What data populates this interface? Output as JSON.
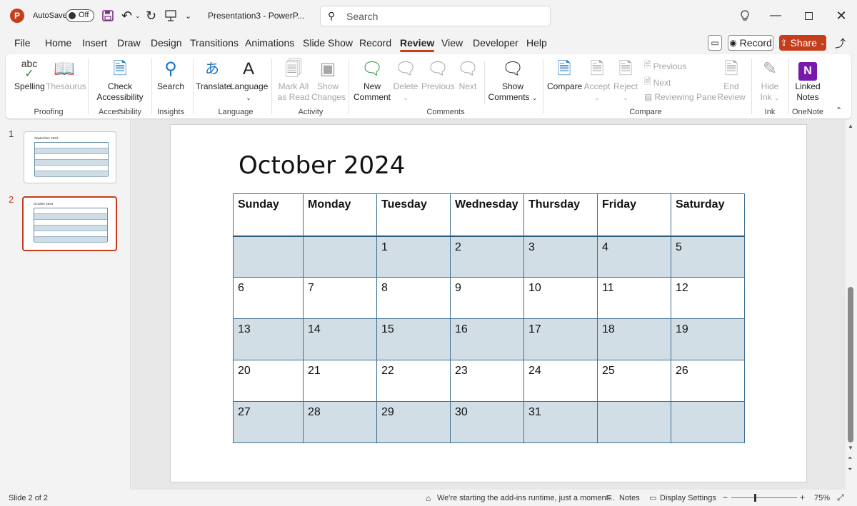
{
  "app": {
    "logo_letter": "P",
    "autosave_label": "AutoSave",
    "autosave_state": "Off",
    "document_title": "Presentation3  -  PowerP...",
    "search_placeholder": "Search",
    "brand_color": "#c43e1c"
  },
  "tabs": [
    "File",
    "Home",
    "Insert",
    "Draw",
    "Design",
    "Transitions",
    "Animations",
    "Slide Show",
    "Record",
    "Review",
    "View",
    "Developer",
    "Help"
  ],
  "active_tab": "Review",
  "tab_right": {
    "record_label": "Record",
    "share_label": "Share"
  },
  "ribbon": {
    "proofing": {
      "group": "Proofing",
      "spelling": "Spelling",
      "thesaurus": "Thesaurus",
      "spelling_icon_text": "abc"
    },
    "accessibility": {
      "group": "Accessibility",
      "check_line1": "Check",
      "check_line2": "Accessibility"
    },
    "insights": {
      "group": "Insights",
      "search": "Search"
    },
    "language": {
      "group": "Language",
      "translate": "Translate",
      "language": "Language"
    },
    "activity": {
      "group": "Activity",
      "mark_all_1": "Mark All",
      "mark_all_2": "as Read",
      "show_changes_1": "Show",
      "show_changes_2": "Changes"
    },
    "comments": {
      "group": "Comments",
      "new_1": "New",
      "new_2": "Comment",
      "delete": "Delete",
      "previous": "Previous",
      "next": "Next",
      "show_1": "Show",
      "show_2": "Comments"
    },
    "compare": {
      "group": "Compare",
      "compare": "Compare",
      "accept": "Accept",
      "reject": "Reject",
      "previous": "Previous",
      "next": "Next",
      "reviewing_pane": "Reviewing Pane",
      "end_1": "End",
      "end_2": "Review"
    },
    "ink": {
      "group": "Ink",
      "hide_1": "Hide",
      "hide_2": "Ink"
    },
    "onenote": {
      "group": "OneNote",
      "linked_1": "Linked",
      "linked_2": "Notes"
    }
  },
  "slides_pane": [
    {
      "number": "1",
      "title": "September 2024"
    },
    {
      "number": "2",
      "title": "October 2024"
    }
  ],
  "slide": {
    "title": "October 2024",
    "headers": [
      "Sunday",
      "Monday",
      "Tuesday",
      "Wednesday",
      "Thursday",
      "Friday",
      "Saturday"
    ],
    "weeks": [
      [
        "",
        "",
        "1",
        "2",
        "3",
        "4",
        "5"
      ],
      [
        "6",
        "7",
        "8",
        "9",
        "10",
        "11",
        "12"
      ],
      [
        "13",
        "14",
        "15",
        "16",
        "17",
        "18",
        "19"
      ],
      [
        "20",
        "21",
        "22",
        "23",
        "24",
        "25",
        "26"
      ],
      [
        "27",
        "28",
        "29",
        "30",
        "31",
        "",
        ""
      ]
    ],
    "shade_color": "#d1dee6",
    "border_color": "#3f6f93"
  },
  "status": {
    "slide_indicator": "Slide 2 of 2",
    "addin_message": "We're starting the add-ins runtime, just a moment...",
    "notes": "Notes",
    "display_settings": "Display Settings",
    "zoom": "75%"
  }
}
